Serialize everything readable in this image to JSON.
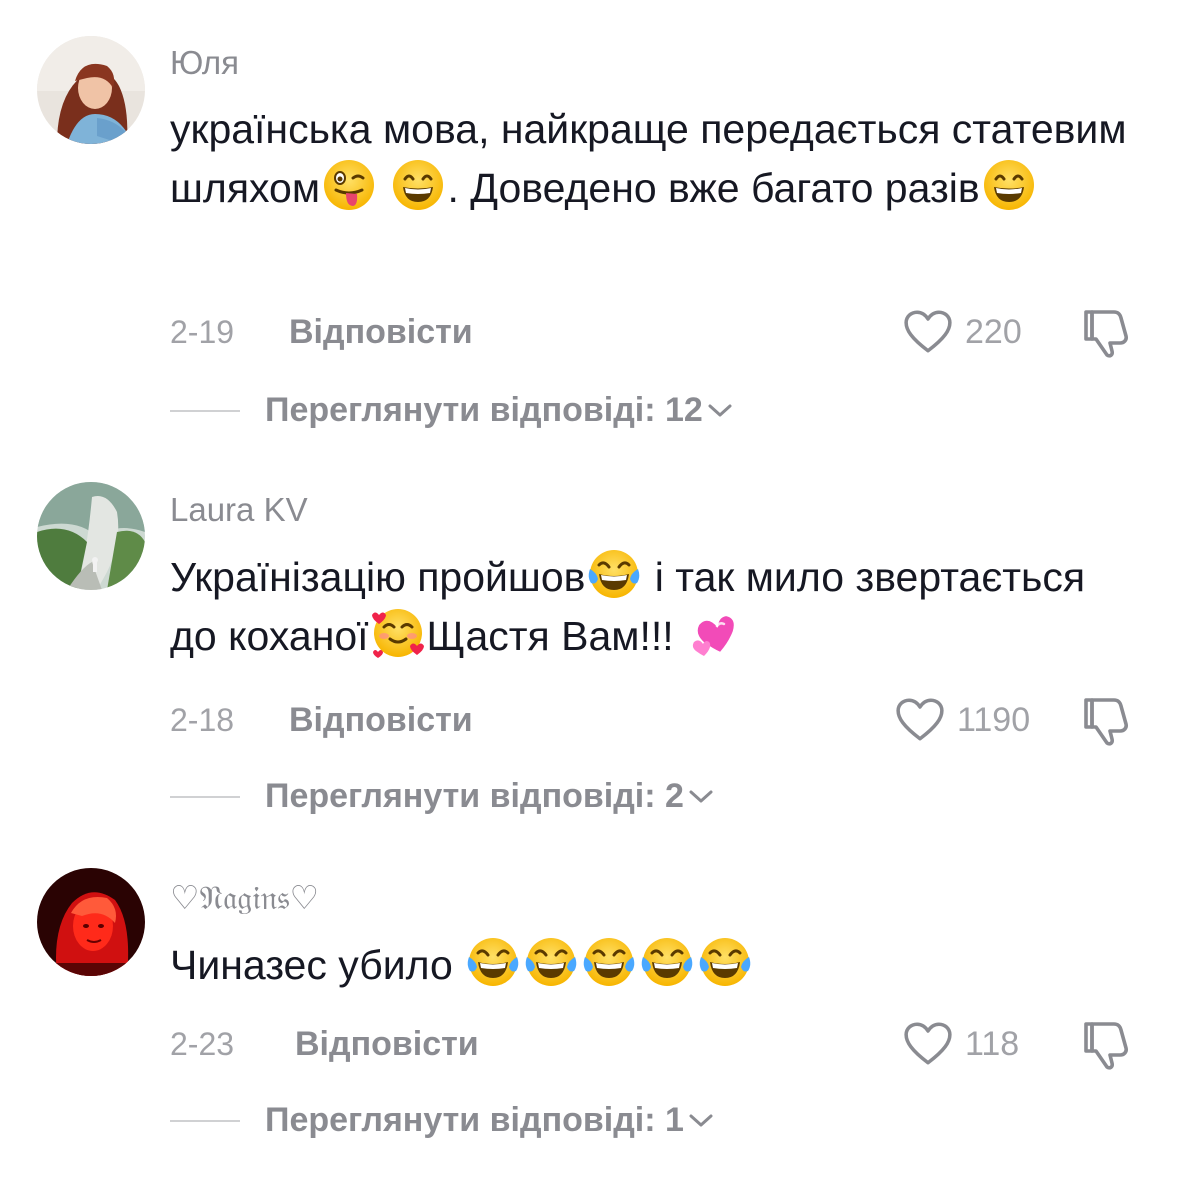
{
  "comments": [
    {
      "username": "Юля",
      "text_parts": [
        "українська мова, найкраще передається статевим шляхом",
        ". Доведено вже багато разів"
      ],
      "date": "2-19",
      "reply_label": "Відповісти",
      "likes": "220",
      "view_replies": "Переглянути відповіді: 12",
      "emojis": [
        "winking-tongue-emoji",
        "grinning-emoji",
        "grinning-emoji"
      ]
    },
    {
      "username": "Laura KV",
      "text_parts": [
        "Українізацію пройшов",
        " і так мило звертається до коханої",
        "Щастя Вам!!! "
      ],
      "date": "2-18",
      "reply_label": "Відповісти",
      "likes": "1190",
      "view_replies": "Переглянути відповіді: 2",
      "emojis": [
        "tears-of-joy-emoji",
        "smiling-hearts-emoji",
        "revolving-hearts-emoji"
      ]
    },
    {
      "username": "♡𝔑𝔞𝔤𝔦𝔫𝔰♡",
      "text_parts": [
        "Чиназес убило "
      ],
      "date": "2-23",
      "reply_label": "Відповісти",
      "likes": "118",
      "view_replies": "Переглянути відповіді: 1",
      "emojis": [
        "tears-of-joy-emoji",
        "tears-of-joy-emoji",
        "tears-of-joy-emoji",
        "tears-of-joy-emoji",
        "tears-of-joy-emoji"
      ]
    }
  ],
  "colors": {
    "text": "#161823",
    "secondary": "#8a8b91",
    "muted": "#a1a2a7",
    "divider": "#d0d1d3"
  }
}
